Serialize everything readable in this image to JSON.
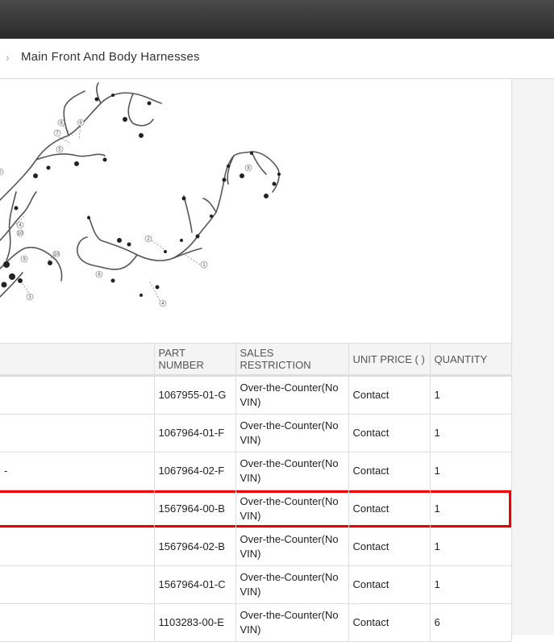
{
  "breadcrumb": {
    "separator": "›",
    "title": "Main Front And Body Harnesses"
  },
  "table": {
    "headers": [
      "",
      "PART NUMBER",
      "SALES RESTRICTION",
      "UNIT PRICE ( )",
      "QUANTITY"
    ],
    "rows": [
      {
        "desc": "",
        "part": "1067955-01-G",
        "restriction": "Over-the-Counter(No VIN)",
        "price": "Contact",
        "qty": "1"
      },
      {
        "desc": "",
        "part": "1067964-01-F",
        "restriction": "Over-the-Counter(No VIN)",
        "price": "Contact",
        "qty": "1"
      },
      {
        "desc": "-",
        "part": "1067964-02-F",
        "restriction": "Over-the-Counter(No VIN)",
        "price": "Contact",
        "qty": "1"
      },
      {
        "desc": "",
        "part": "1567964-00-B",
        "restriction": "Over-the-Counter(No VIN)",
        "price": "Contact",
        "qty": "1"
      },
      {
        "desc": "",
        "part": "1567964-02-B",
        "restriction": "Over-the-Counter(No VIN)",
        "price": "Contact",
        "qty": "1"
      },
      {
        "desc": "",
        "part": "1567964-01-C",
        "restriction": "Over-the-Counter(No VIN)",
        "price": "Contact",
        "qty": "1"
      },
      {
        "desc": "",
        "part": "1103283-00-E",
        "restriction": "Over-the-Counter(No VIN)",
        "price": "Contact",
        "qty": "6"
      }
    ]
  },
  "diagram_callouts": [
    "8",
    "6",
    "7",
    "5",
    "2",
    "4",
    "10",
    "9",
    "10",
    "3",
    "8",
    "6",
    "1",
    "4",
    "2",
    "3"
  ],
  "colors": {
    "highlight": "#e00000",
    "header_bg": "#f4f4f4",
    "topbar": "#333333"
  }
}
